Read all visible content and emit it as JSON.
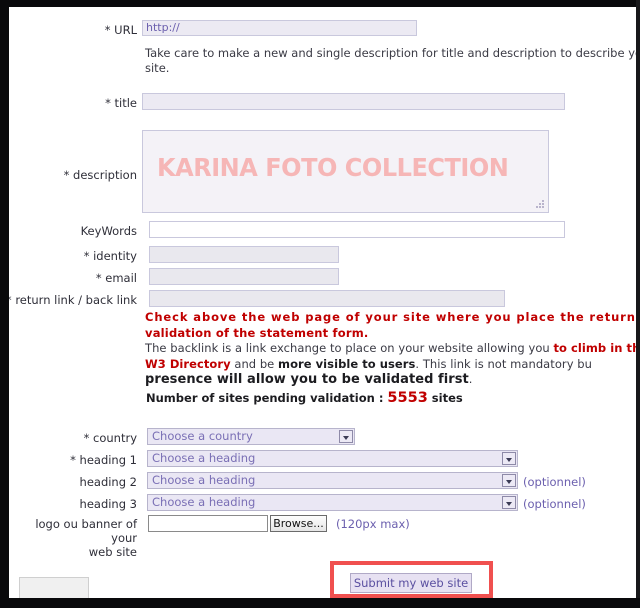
{
  "form": {
    "fields": [
      {
        "name": "url",
        "label": "* URL",
        "value": "http://",
        "placeholder": "http://"
      },
      {
        "name": "title",
        "label": "* title",
        "value": "",
        "placeholder": ""
      },
      {
        "name": "description",
        "label": "* description",
        "value": "",
        "watermark": "KARINA FOTO COLLECTION"
      },
      {
        "name": "keywords",
        "label": "KeyWords",
        "value": "",
        "placeholder": ""
      },
      {
        "name": "identity",
        "label": "* identity",
        "value": "",
        "placeholder": ""
      },
      {
        "name": "email",
        "label": "* email",
        "value": "",
        "placeholder": ""
      },
      {
        "name": "return_link",
        "label": "* return link / back link",
        "value": "",
        "placeholder": ""
      }
    ],
    "instruction": {
      "line1": "Take care to make a new and single description for title and description to describe your w",
      "line2": "site."
    },
    "notice": {
      "bold_red_line1": "Check above the web page of your site where you place the return link",
      "bold_red_line2": "validation of the statement form.",
      "p_part1": "The backlink is a link exchange to place on your website allowing you ",
      "p_red1": "to climb in the ov",
      "p_red2": "W3 Directory",
      "p_part2": " and be ",
      "p_bold1": "more visible to users",
      "p_part3": ". This link is not mandatory bu",
      "p_big": "presence will allow you to be validated first",
      "p_end": "."
    },
    "pending": {
      "prefix": "Number of sites pending validation : ",
      "count": "5553",
      "suffix": " sites"
    },
    "selects": [
      {
        "name": "country",
        "label": "* country",
        "value": "Choose a country",
        "note": ""
      },
      {
        "name": "heading1",
        "label": "* heading 1",
        "value": "Choose a heading",
        "note": ""
      },
      {
        "name": "heading2",
        "label": "heading 2",
        "value": "Choose a heading",
        "note": "(optionnel)"
      },
      {
        "name": "heading3",
        "label": "heading 3",
        "value": "Choose a heading",
        "note": "(optionnel)"
      }
    ],
    "logo": {
      "label_line1": "logo ou banner of your",
      "label_line2": "web site",
      "browse_label": "Browse...",
      "file_value": "",
      "note": "(120px max)"
    },
    "submit": {
      "label": "Submit my web site"
    }
  },
  "colors": {
    "red_text": "#c00000",
    "callout_red": "#f0504f",
    "purple_text": "#6b5fae",
    "watermark": "#f6b6b6"
  }
}
